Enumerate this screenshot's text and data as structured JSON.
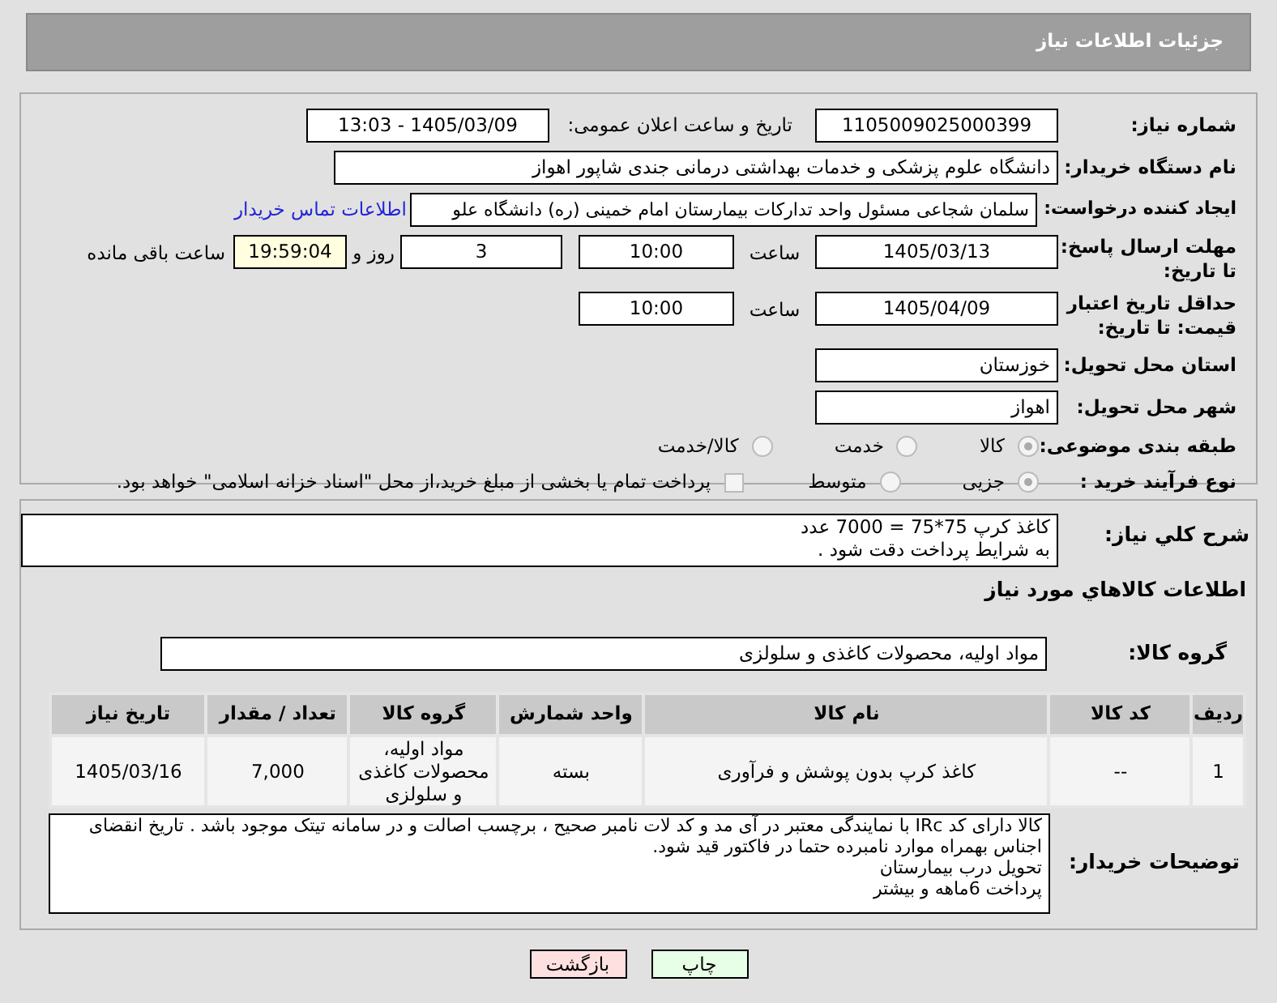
{
  "header": {
    "title": "جزئیات اطلاعات نیاز"
  },
  "need_number": {
    "label": "شماره نیاز:",
    "value": "1105009025000399"
  },
  "announce": {
    "label": "تاریخ و ساعت اعلان عمومی:",
    "value": "1405/03/09 - 13:03"
  },
  "buyer": {
    "label": "نام دستگاه خریدار:",
    "value": "دانشگاه علوم پزشکی و خدمات بهداشتی درمانی جندی شاپور اهواز"
  },
  "requester": {
    "label": "ایجاد کننده درخواست:",
    "value": "سلمان شجاعی مسئول واحد تدارکات بیمارستان امام خمینی (ره) دانشگاه علو",
    "link": "اطلاعات تماس خریدار"
  },
  "deadline": {
    "label": "مهلت ارسال پاسخ: تا تاریخ:",
    "date": "1405/03/13",
    "time_label": "ساعت",
    "time": "10:00",
    "days": "3",
    "days_label": "روز و",
    "remaining": "19:59:04",
    "remaining_label": "ساعت باقی مانده"
  },
  "validity": {
    "label": "حداقل تاریخ اعتبار قیمت: تا تاریخ:",
    "date": "1405/04/09",
    "time_label": "ساعت",
    "time": "10:00"
  },
  "province": {
    "label": "استان محل تحویل:",
    "value": "خوزستان"
  },
  "city": {
    "label": "شهر محل تحویل:",
    "value": "اهواز"
  },
  "category": {
    "label": "طبقه بندی موضوعی:",
    "options": [
      {
        "label": "کالا",
        "selected": true
      },
      {
        "label": "خدمت",
        "selected": false
      },
      {
        "label": "کالا/خدمت",
        "selected": false
      }
    ]
  },
  "process": {
    "label": "نوع فرآیند خرید :",
    "options": [
      {
        "label": "جزیی",
        "selected": true
      },
      {
        "label": "متوسط",
        "selected": false
      }
    ],
    "checkbox": {
      "label": "پرداخت تمام یا بخشی از مبلغ خرید،از محل \"اسناد خزانه اسلامی\" خواهد بود.",
      "checked": false
    }
  },
  "description": {
    "label": "شرح کلي نياز:",
    "lines": [
      "کاغذ کرپ 75*75 =  7000 عدد",
      "به شرایط پرداخت دقت شود ."
    ]
  },
  "goods_title": "اطلاعات کالاهاي مورد نياز",
  "goods_group": {
    "label": "گروه کالا:",
    "value": "مواد اولیه، محصولات کاغذی و سلولزی"
  },
  "table": {
    "columns": [
      "ردیف",
      "کد کالا",
      "نام کالا",
      "واحد شمارش",
      "گروه کالا",
      "تعداد / مقدار",
      "تاریخ نیاز"
    ],
    "rows": [
      [
        "1",
        "--",
        "کاغذ کرپ بدون پوشش و فرآوری",
        "بسته",
        "مواد اولیه، محصولات کاغذی و سلولزی",
        "7,000",
        "1405/03/16"
      ]
    ]
  },
  "buyer_notes": {
    "label": "توضیحات خریدار:",
    "lines": [
      "کالا دارای کد IRc با نمایندگی معتبر در آی مد و کد لات نامبر صحیح ، برچسب اصالت و در سامانه تیتک موجود باشد . تاریخ انقضای اجناس بهمراه موارد نامبرده حتما در فاکتور قید شود.",
      "تحویل درب بیمارستان",
      "پرداخت 6ماهه و بیشتر"
    ]
  },
  "buttons": [
    {
      "label": "چاپ",
      "kind": "print"
    },
    {
      "label": "بازگشت",
      "kind": "back"
    }
  ]
}
